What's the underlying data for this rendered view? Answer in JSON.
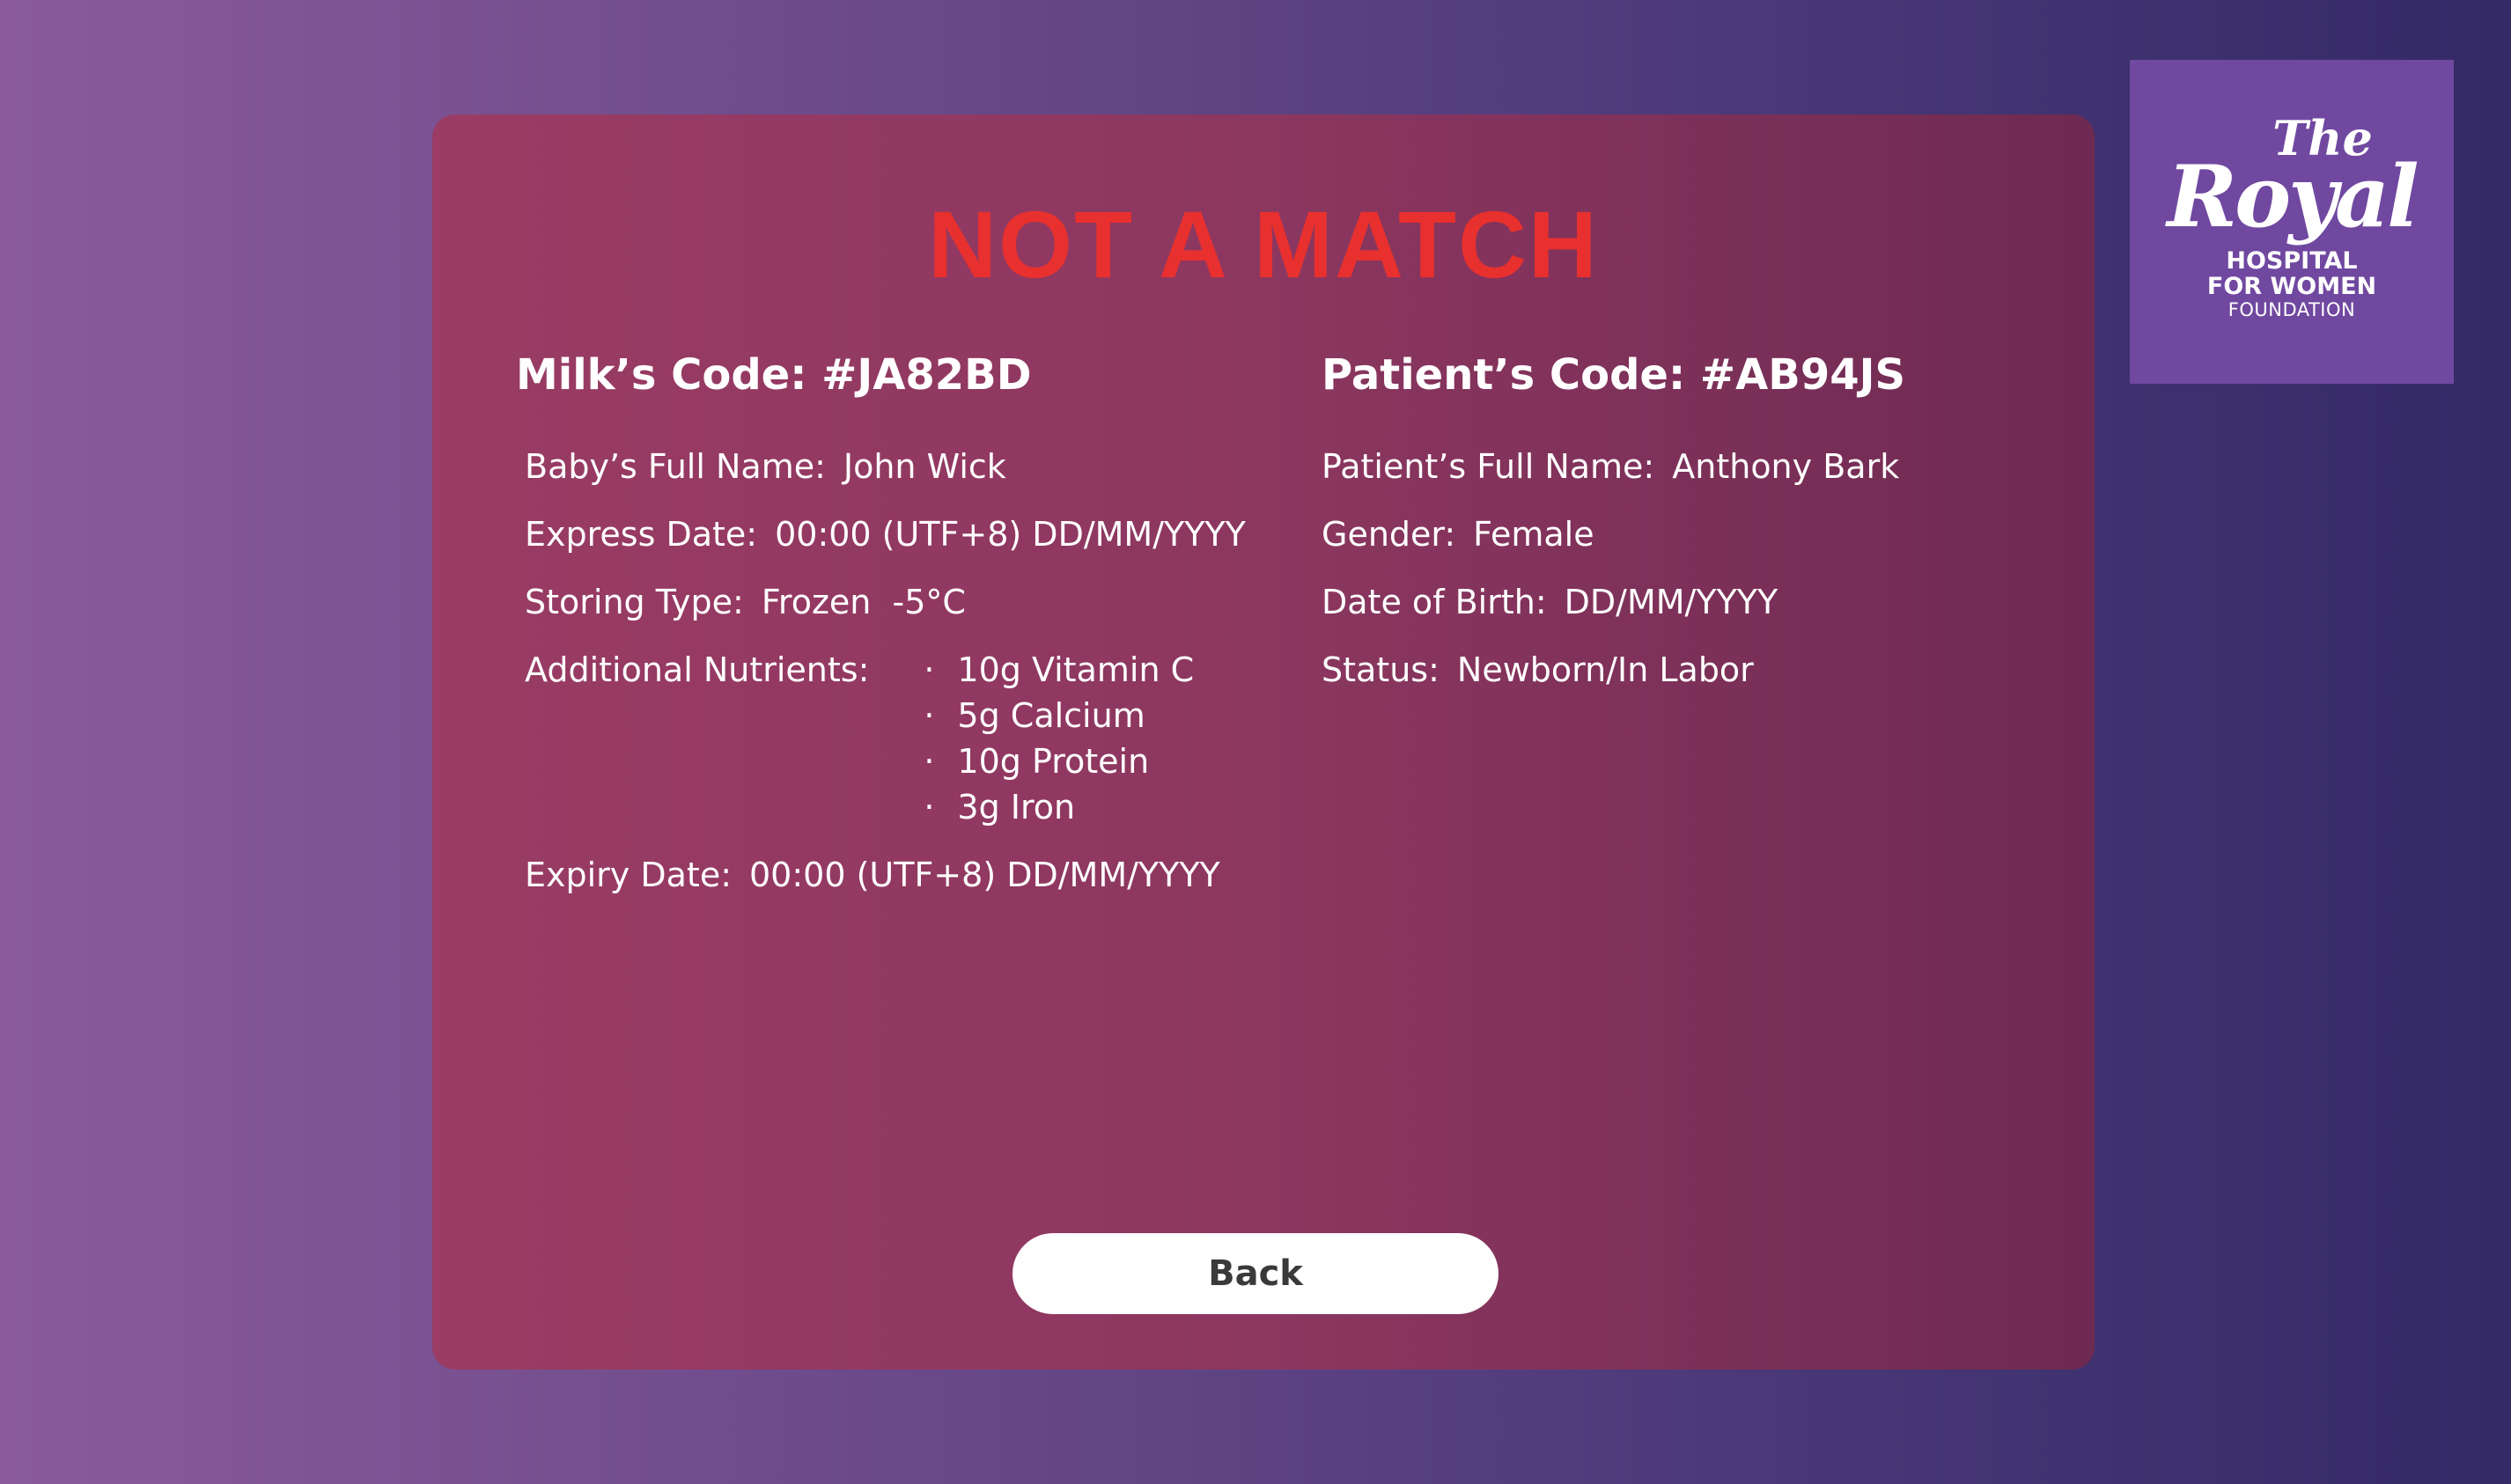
{
  "logo": {
    "line_the": "The",
    "line_royal": "Royal",
    "line_hospital": "HOSPITAL",
    "line_for_women": "FOR WOMEN",
    "line_foundation": "FOUNDATION"
  },
  "result": {
    "title": "NOT A MATCH",
    "title_color": "#e8302e"
  },
  "milk": {
    "code_label": "Milk’s Code:",
    "code_value": "#JA82BD",
    "baby_name_label": "Baby’s Full Name:",
    "baby_name_value": "John Wick",
    "express_date_label": "Express Date:",
    "express_date_value": "00:00 (UTF+8) DD/MM/YYYY",
    "storing_type_label": "Storing Type:",
    "storing_type_value": "Frozen  -5°C",
    "nutrients_label": "Additional Nutrients:",
    "nutrients": [
      "10g Vitamin C",
      "5g Calcium",
      "10g Protein",
      "3g Iron"
    ],
    "expiry_date_label": "Expiry Date:",
    "expiry_date_value": "00:00 (UTF+8) DD/MM/YYYY"
  },
  "patient": {
    "code_label": "Patient’s Code:",
    "code_value": "#AB94JS",
    "full_name_label": "Patient’s Full Name:",
    "full_name_value": "Anthony Bark",
    "gender_label": "Gender:",
    "gender_value": "Female",
    "dob_label": "Date of Birth:",
    "dob_value": "DD/MM/YYYY",
    "status_label": "Status:",
    "status_value": "Newborn/In Labor"
  },
  "actions": {
    "back_label": "Back"
  }
}
